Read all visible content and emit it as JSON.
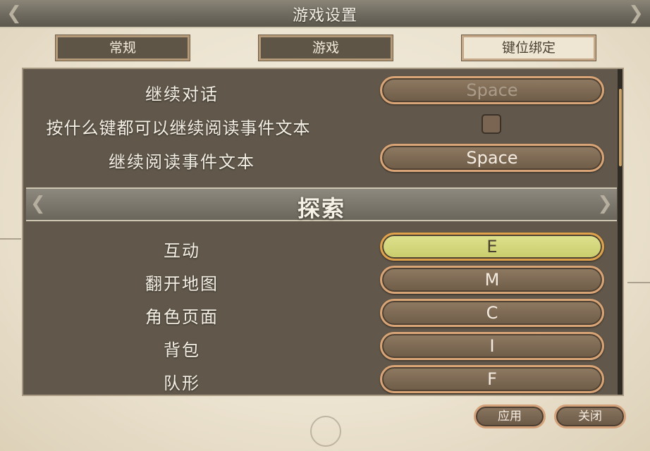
{
  "window": {
    "title": "游戏设置"
  },
  "tabs": [
    {
      "label": "常规",
      "active": false
    },
    {
      "label": "游戏",
      "active": false
    },
    {
      "label": "键位绑定",
      "active": true
    }
  ],
  "dialogue_rows": [
    {
      "label": "继续对话",
      "key": "Space",
      "state": "disabled"
    },
    {
      "label": "按什么键都可以继续阅读事件文本",
      "checkbox_checked": false
    },
    {
      "label": "继续阅读事件文本",
      "key": "Space",
      "state": "normal"
    }
  ],
  "explore_section": {
    "title": "探索",
    "rows": [
      {
        "label": "互动",
        "key": "E",
        "state": "highlight"
      },
      {
        "label": "翻开地图",
        "key": "M",
        "state": "normal"
      },
      {
        "label": "角色页面",
        "key": "C",
        "state": "normal"
      },
      {
        "label": "背包",
        "key": "I",
        "state": "normal"
      },
      {
        "label": "队形",
        "key": "F",
        "state": "normal"
      }
    ]
  },
  "footer": {
    "apply_label": "应用",
    "close_label": "关闭"
  },
  "icons": [
    "title-cap-left-icon",
    "title-cap-right-icon",
    "section-cap-left-icon",
    "section-cap-right-icon"
  ],
  "colors": {
    "panel_bg": "#61584b",
    "highlight_key": "#d4d67c",
    "key_border": "#d9a476"
  }
}
